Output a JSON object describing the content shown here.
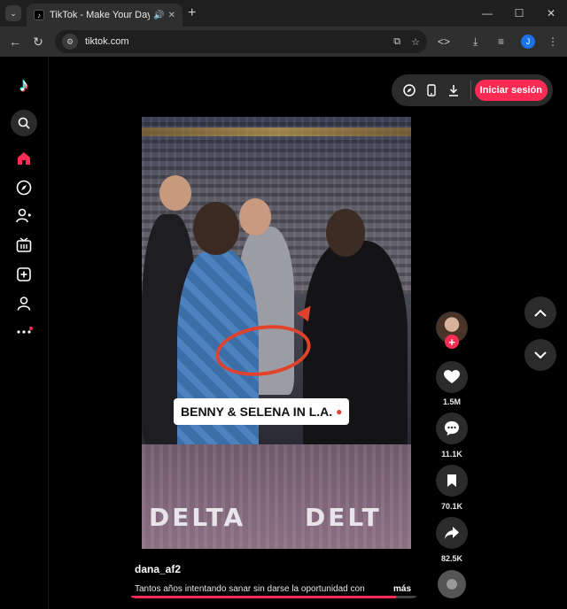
{
  "browser": {
    "tab_title": "TikTok - Make Your Day",
    "url": "tiktok.com",
    "profile_initial": "J"
  },
  "sidebar": {
    "items": [
      "search-icon",
      "home-icon",
      "explore-icon",
      "following-icon",
      "live-icon",
      "upload-icon",
      "profile-icon",
      "more-icon"
    ]
  },
  "top_bar": {
    "login_label": "Iniciar sesión"
  },
  "video": {
    "caption_overlay": "BENNY & SELENA IN L.A.",
    "seat_text_left": "DELTA",
    "seat_text_right": "DELT",
    "author": "dana_af2",
    "description": "Tantos años intentando sanar sin darse la oportunidad con",
    "more_label": "más",
    "progress": 0.93
  },
  "actions": {
    "likes": "1.5M",
    "comments": "11.1K",
    "saves": "70.1K",
    "shares": "82.5K"
  },
  "colors": {
    "accent": "#fe2c55",
    "surface": "#2b2b2b",
    "background": "#000000",
    "overlay_marker": "#e0422c"
  }
}
